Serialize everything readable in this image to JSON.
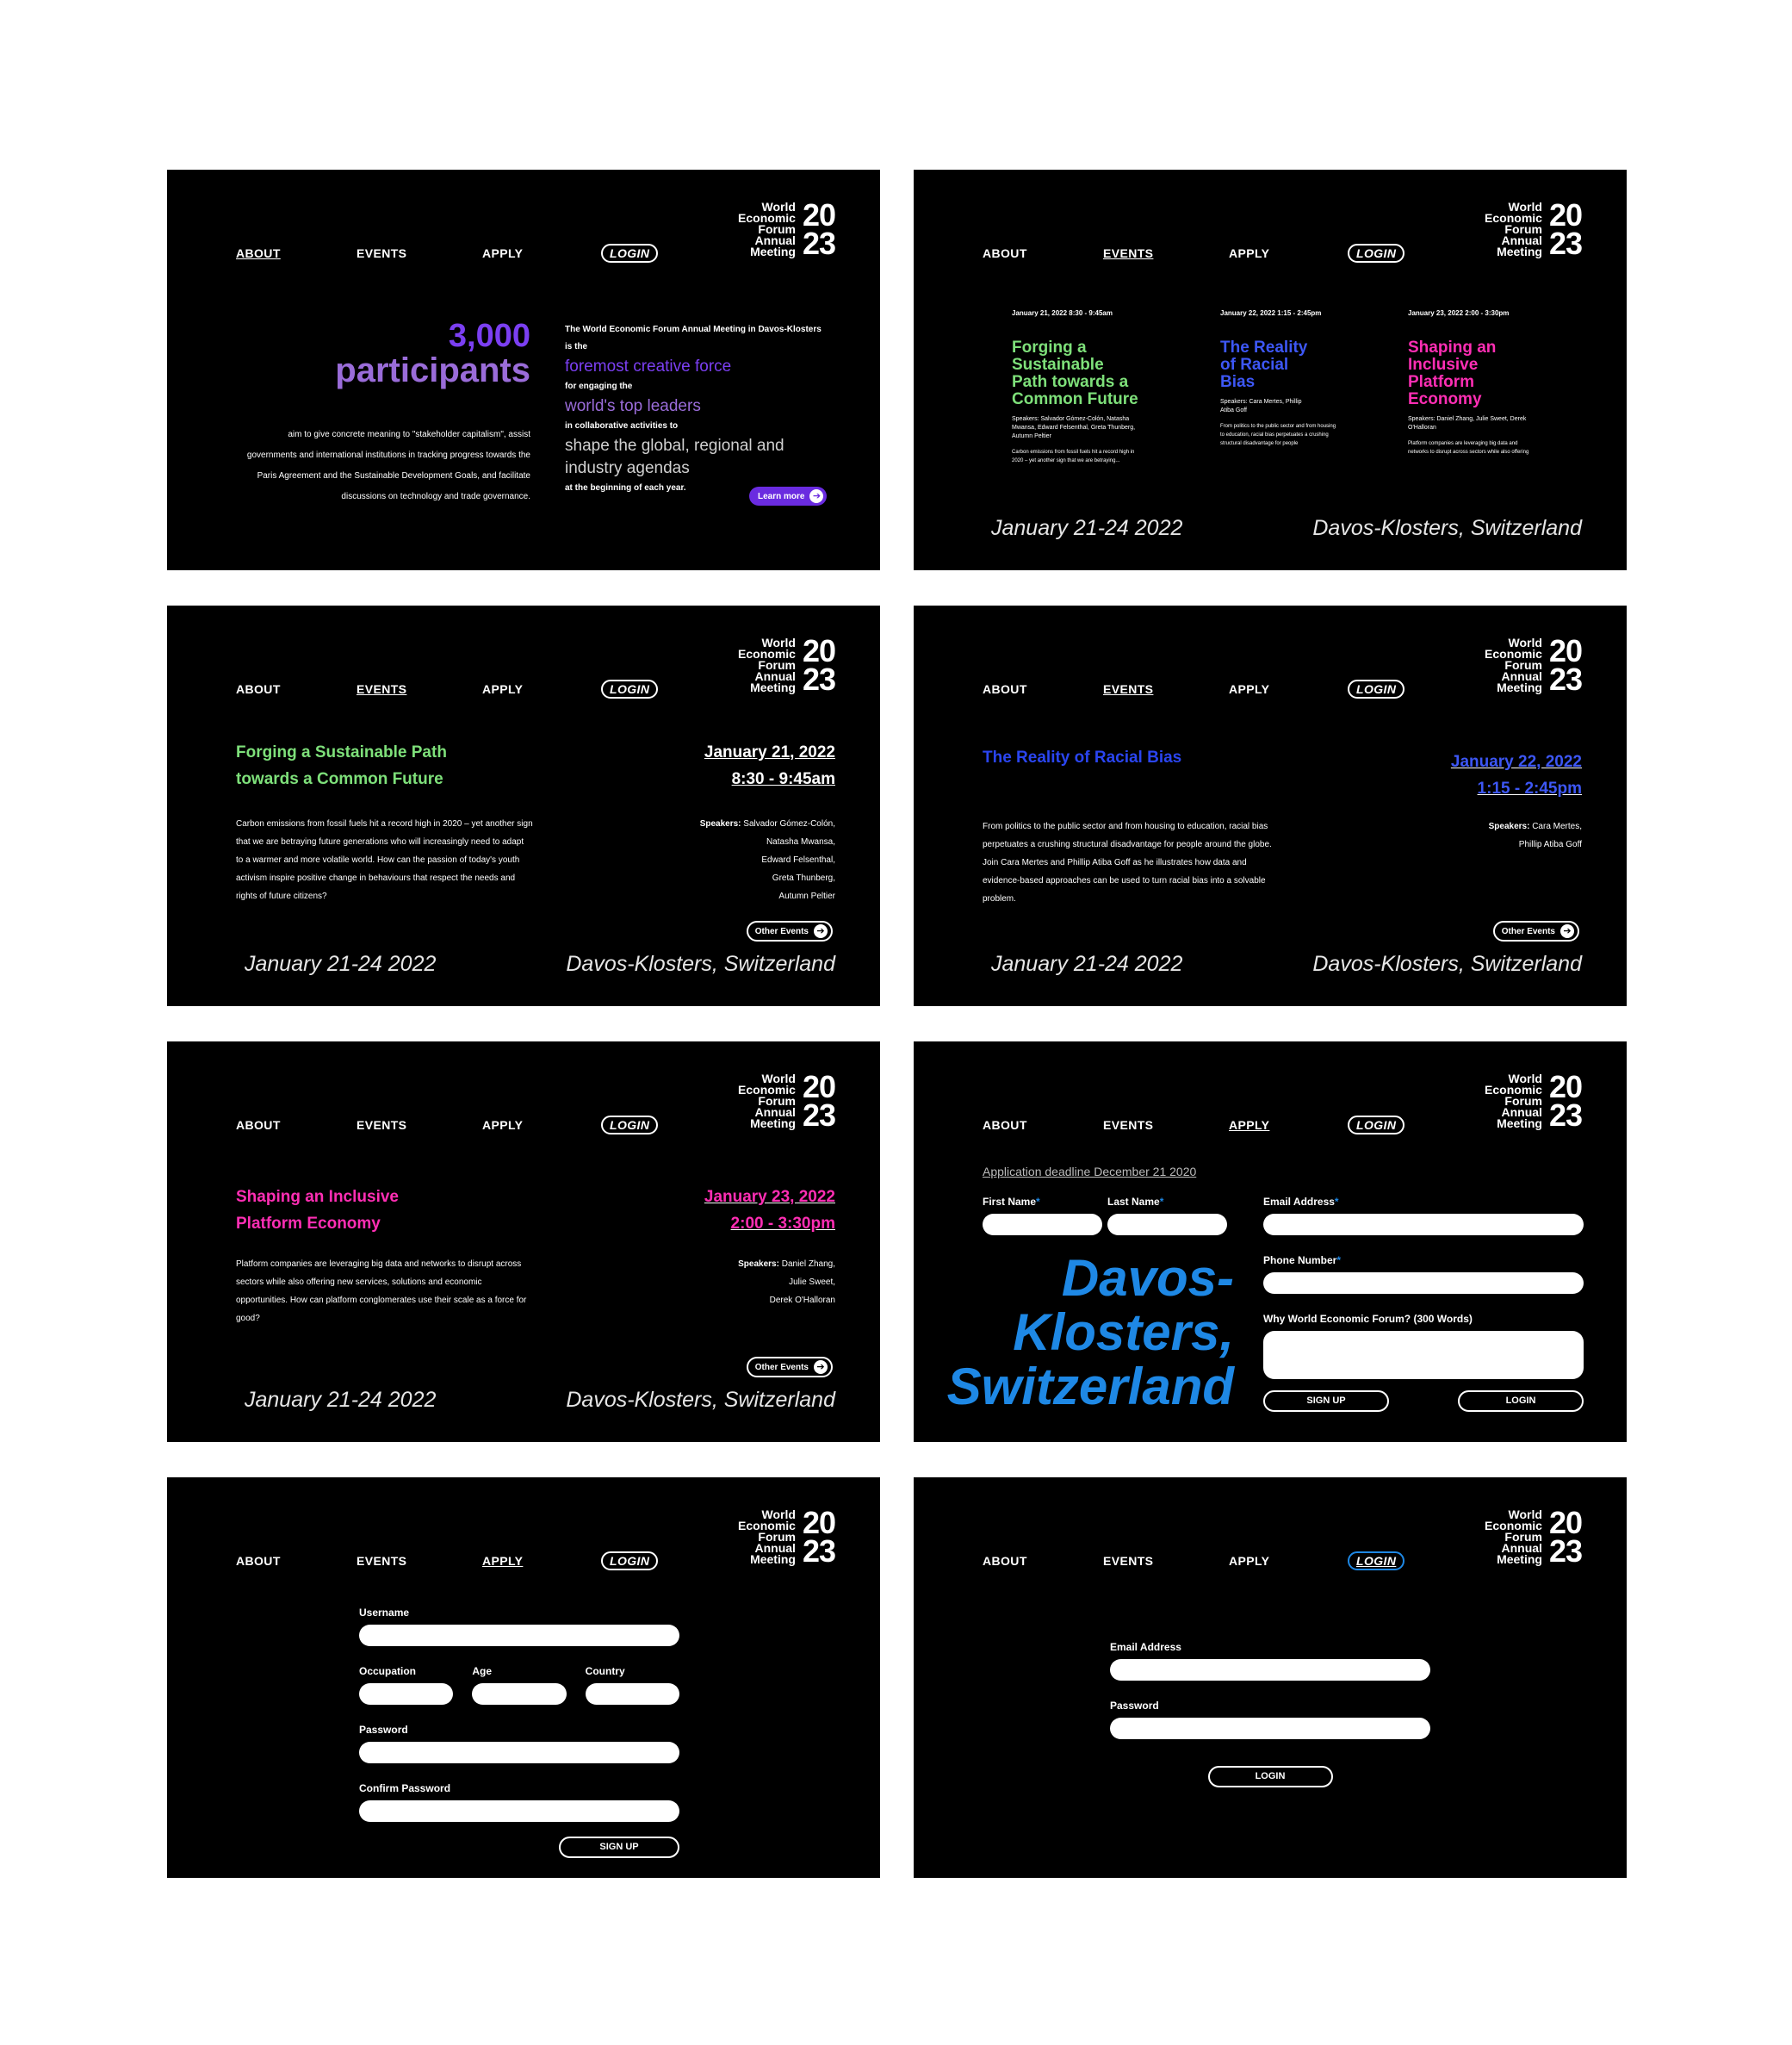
{
  "logo": {
    "words": [
      "World",
      "Economic",
      "Forum",
      "Annual",
      "Meeting"
    ],
    "year_top": "20",
    "year_bottom": "23"
  },
  "nav": {
    "about": "ABOUT",
    "events": "EVENTS",
    "apply": "APPLY",
    "login": "LOGIN"
  },
  "footer": {
    "dates": "January 21-24 2022",
    "location": "Davos-Klosters, Switzerland"
  },
  "about": {
    "stat_number": "3,000",
    "stat_label": "participants",
    "intro": "aim to give concrete meaning to \"stakeholder capitalism\", assist governments and international institutions in tracking progress towards the Paris Agreement and the Sustainable Development Goals, and facilitate discussions on technology and trade governance.",
    "p1": "The World Economic Forum Annual Meeting in Davos-Klosters is the",
    "h1": "foremost creative force",
    "p2": "for engaging the",
    "h2": "world's top leaders",
    "p3": "in collaborative activities to",
    "h3": "shape the global, regional and industry agendas",
    "p4": "at the beginning of each year.",
    "learn_more": "Learn more"
  },
  "events_list": [
    {
      "date": "January 21, 2022 8:30 - 9:45am",
      "title": "Forging a Sustainable Path towards a Common Future",
      "speakers": "Speakers: Salvador Gómez-Colón, Natasha Mwansa, Edward Felsenthal, Greta Thunberg, Autumn Peltier",
      "snippet": "Carbon emissions from fossil fuels hit a record high in 2020 – yet another sign that we are betraying...",
      "color": "#7ee07a"
    },
    {
      "date": "January 22, 2022 1:15 - 2:45pm",
      "title": "The Reality of Racial Bias",
      "speakers": "Speakers: Cara Mertes, Phillip Atiba Goff",
      "snippet": "From politics to the public sector and from housing to education, racial bias perpetuates a crushing structural disadvantage for people",
      "color": "#3d57f5"
    },
    {
      "date": "January 23, 2022 2:00 - 3:30pm",
      "title": "Shaping an Inclusive Platform Economy",
      "speakers": "Speakers: Daniel Zhang, Julie Sweet, Derek O'Halloran",
      "snippet": "Platform companies are leveraging big data and networks to disrupt across sectors while also offering",
      "color": "#ff2eb4"
    }
  ],
  "event1": {
    "title": "Forging a Sustainable Path towards a Common Future",
    "date": "January 21, 2022",
    "time": "8:30 - 9:45am",
    "desc": "Carbon emissions from fossil fuels hit a record high in 2020 – yet another sign that we are betraying future generations who will increasingly need to adapt to a warmer and more volatile world. How can the passion of today's youth activism inspire positive change in behaviours that respect the needs and rights of future citizens?",
    "speakers_label": "Speakers:",
    "speakers": [
      "Salvador Gómez-Colón,",
      "Natasha Mwansa,",
      "Edward Felsenthal,",
      "Greta Thunberg,",
      "Autumn Peltier"
    ],
    "color": "#7ee07a"
  },
  "event2": {
    "title": "The Reality of Racial Bias",
    "date": "January 22, 2022",
    "time": "1:15 - 2:45pm",
    "desc": "From politics to the public sector and from housing to education, racial bias perpetuates a crushing structural disadvantage for people around the globe. Join Cara Mertes and Phillip Atiba Goff as he illustrates how data and evidence-based approaches can be used to turn racial bias into a solvable problem.",
    "speakers_label": "Speakers:",
    "speakers": [
      "Cara Mertes,",
      "Phillip Atiba Goff"
    ],
    "color": "#2a45f0"
  },
  "event3": {
    "title": "Shaping an Inclusive Platform Economy",
    "date": "January 23, 2022",
    "time": "2:00 - 3:30pm",
    "desc": "Platform companies are leveraging big data and networks to disrupt across sectors while also offering new services, solutions and economic opportunities. How can platform conglomerates use their scale as a force for good?",
    "speakers_label": "Speakers:",
    "speakers": [
      "Daniel Zhang,",
      "Julie Sweet,",
      "Derek O'Halloran"
    ],
    "color": "#ff2eb4"
  },
  "other_events": "Other Events",
  "apply": {
    "deadline": "Application deadline December 21 2020",
    "first_name": "First Name",
    "last_name": "Last Name",
    "email": "Email Address",
    "phone": "Phone Number",
    "why": "Why World Economic Forum? (300 Words)",
    "big_text": [
      "Davos-",
      "Klosters,",
      "Switzerland"
    ],
    "signup": "SIGN UP",
    "login": "LOGIN"
  },
  "signup": {
    "username": "Username",
    "occupation": "Occupation",
    "age": "Age",
    "country": "Country",
    "password": "Password",
    "confirm": "Confirm Password",
    "button": "SIGN UP"
  },
  "login": {
    "email": "Email Address",
    "password": "Password",
    "button": "LOGIN"
  },
  "colors": {
    "purple": "#7b3ff2",
    "blue": "#1e88e5",
    "green": "#7ee07a",
    "pink": "#ff2eb4"
  }
}
